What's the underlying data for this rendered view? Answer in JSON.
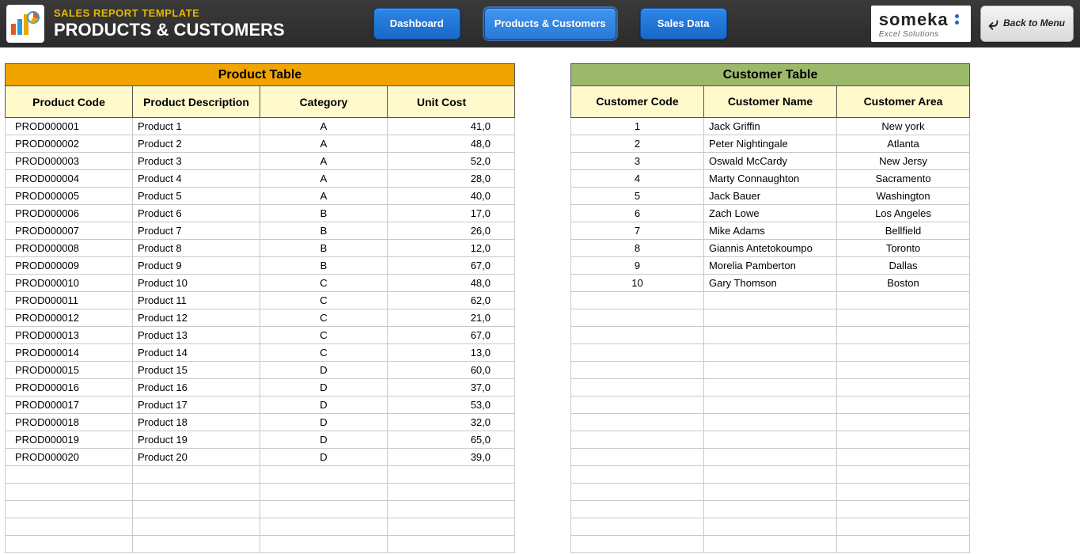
{
  "header": {
    "template_title": "SALES REPORT TEMPLATE",
    "page_title": "PRODUCTS & CUSTOMERS",
    "logo_main": "someka",
    "logo_sub": "Excel Solutions",
    "back_label": "Back to Menu"
  },
  "nav": {
    "dashboard": "Dashboard",
    "products_customers": "Products & Customers",
    "sales_data": "Sales Data"
  },
  "product_table": {
    "title": "Product Table",
    "headers": {
      "code": "Product Code",
      "desc": "Product Description",
      "cat": "Category",
      "cost": "Unit Cost"
    },
    "rows": [
      {
        "code": "PROD000001",
        "desc": "Product 1",
        "cat": "A",
        "cost": "41,0"
      },
      {
        "code": "PROD000002",
        "desc": "Product 2",
        "cat": "A",
        "cost": "48,0"
      },
      {
        "code": "PROD000003",
        "desc": "Product 3",
        "cat": "A",
        "cost": "52,0"
      },
      {
        "code": "PROD000004",
        "desc": "Product 4",
        "cat": "A",
        "cost": "28,0"
      },
      {
        "code": "PROD000005",
        "desc": "Product 5",
        "cat": "A",
        "cost": "40,0"
      },
      {
        "code": "PROD000006",
        "desc": "Product 6",
        "cat": "B",
        "cost": "17,0"
      },
      {
        "code": "PROD000007",
        "desc": "Product 7",
        "cat": "B",
        "cost": "26,0"
      },
      {
        "code": "PROD000008",
        "desc": "Product 8",
        "cat": "B",
        "cost": "12,0"
      },
      {
        "code": "PROD000009",
        "desc": "Product 9",
        "cat": "B",
        "cost": "67,0"
      },
      {
        "code": "PROD000010",
        "desc": "Product 10",
        "cat": "C",
        "cost": "48,0"
      },
      {
        "code": "PROD000011",
        "desc": "Product 11",
        "cat": "C",
        "cost": "62,0"
      },
      {
        "code": "PROD000012",
        "desc": "Product 12",
        "cat": "C",
        "cost": "21,0"
      },
      {
        "code": "PROD000013",
        "desc": "Product 13",
        "cat": "C",
        "cost": "67,0"
      },
      {
        "code": "PROD000014",
        "desc": "Product 14",
        "cat": "C",
        "cost": "13,0"
      },
      {
        "code": "PROD000015",
        "desc": "Product 15",
        "cat": "D",
        "cost": "60,0"
      },
      {
        "code": "PROD000016",
        "desc": "Product 16",
        "cat": "D",
        "cost": "37,0"
      },
      {
        "code": "PROD000017",
        "desc": "Product 17",
        "cat": "D",
        "cost": "53,0"
      },
      {
        "code": "PROD000018",
        "desc": "Product 18",
        "cat": "D",
        "cost": "32,0"
      },
      {
        "code": "PROD000019",
        "desc": "Product 19",
        "cat": "D",
        "cost": "65,0"
      },
      {
        "code": "PROD000020",
        "desc": "Product 20",
        "cat": "D",
        "cost": "39,0"
      }
    ],
    "empty_rows": 5
  },
  "customer_table": {
    "title": "Customer Table",
    "headers": {
      "code": "Customer Code",
      "name": "Customer Name",
      "area": "Customer Area"
    },
    "rows": [
      {
        "code": "1",
        "name": "Jack Griffin",
        "area": "New york"
      },
      {
        "code": "2",
        "name": "Peter Nightingale",
        "area": "Atlanta"
      },
      {
        "code": "3",
        "name": "Oswald McCardy",
        "area": "New Jersy"
      },
      {
        "code": "4",
        "name": "Marty Connaughton",
        "area": "Sacramento"
      },
      {
        "code": "5",
        "name": "Jack Bauer",
        "area": "Washington"
      },
      {
        "code": "6",
        "name": "Zach Lowe",
        "area": "Los Angeles"
      },
      {
        "code": "7",
        "name": "Mike Adams",
        "area": "Bellfield"
      },
      {
        "code": "8",
        "name": "Giannis Antetokoumpo",
        "area": "Toronto"
      },
      {
        "code": "9",
        "name": "Morelia Pamberton",
        "area": "Dallas"
      },
      {
        "code": "10",
        "name": "Gary Thomson",
        "area": "Boston"
      }
    ],
    "empty_rows": 15
  }
}
